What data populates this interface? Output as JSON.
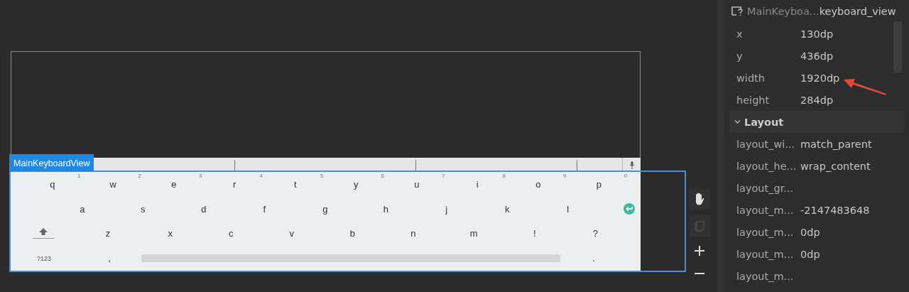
{
  "selection": {
    "label": "MainKeyboardView"
  },
  "keyboard": {
    "rows": [
      {
        "keys": [
          {
            "kind": "letter",
            "label": "q",
            "hint": "1"
          },
          {
            "kind": "letter",
            "label": "w",
            "hint": "2"
          },
          {
            "kind": "letter",
            "label": "e",
            "hint": "3"
          },
          {
            "kind": "letter",
            "label": "r",
            "hint": "4"
          },
          {
            "kind": "letter",
            "label": "t",
            "hint": "5"
          },
          {
            "kind": "letter",
            "label": "y",
            "hint": "6"
          },
          {
            "kind": "letter",
            "label": "u",
            "hint": "7"
          },
          {
            "kind": "letter",
            "label": "i",
            "hint": "8"
          },
          {
            "kind": "letter",
            "label": "o",
            "hint": "9"
          },
          {
            "kind": "letter",
            "label": "p",
            "hint": "0"
          }
        ]
      },
      {
        "keys": [
          {
            "kind": "letter",
            "label": "a"
          },
          {
            "kind": "letter",
            "label": "s"
          },
          {
            "kind": "letter",
            "label": "d"
          },
          {
            "kind": "letter",
            "label": "f"
          },
          {
            "kind": "letter",
            "label": "g"
          },
          {
            "kind": "letter",
            "label": "h"
          },
          {
            "kind": "letter",
            "label": "j"
          },
          {
            "kind": "letter",
            "label": "k"
          },
          {
            "kind": "letter",
            "label": "l"
          },
          {
            "kind": "enter"
          }
        ]
      },
      {
        "keys": [
          {
            "kind": "shift"
          },
          {
            "kind": "letter",
            "label": "z"
          },
          {
            "kind": "letter",
            "label": "x"
          },
          {
            "kind": "letter",
            "label": "c"
          },
          {
            "kind": "letter",
            "label": "v"
          },
          {
            "kind": "letter",
            "label": "b"
          },
          {
            "kind": "letter",
            "label": "n"
          },
          {
            "kind": "letter",
            "label": "m"
          },
          {
            "kind": "letter",
            "label": "!"
          },
          {
            "kind": "letter",
            "label": "?"
          }
        ]
      },
      {
        "keys": [
          {
            "kind": "symbols",
            "label": "?123"
          },
          {
            "kind": "punct",
            "label": ","
          },
          {
            "kind": "space"
          },
          {
            "kind": "punct",
            "label": "."
          }
        ]
      }
    ]
  },
  "panel": {
    "header": {
      "class_name": "MainKeyboa...",
      "id": "keyboard_view"
    },
    "properties": [
      {
        "name": "x",
        "value": "130dp"
      },
      {
        "name": "y",
        "value": "436dp"
      },
      {
        "name": "width",
        "value": "1920dp"
      },
      {
        "name": "height",
        "value": "284dp"
      }
    ],
    "sections": [
      {
        "title": "Layout",
        "expanded": true,
        "properties": [
          {
            "name": "layout_wi...",
            "value": "match_parent"
          },
          {
            "name": "layout_he...",
            "value": "wrap_content"
          },
          {
            "name": "layout_gr..."
          },
          {
            "name": "layout_m...",
            "value": "-2147483648"
          },
          {
            "name": "layout_m...",
            "value": "0dp"
          },
          {
            "name": "layout_m...",
            "value": "0dp"
          },
          {
            "name": "layout_m..."
          }
        ]
      }
    ]
  }
}
